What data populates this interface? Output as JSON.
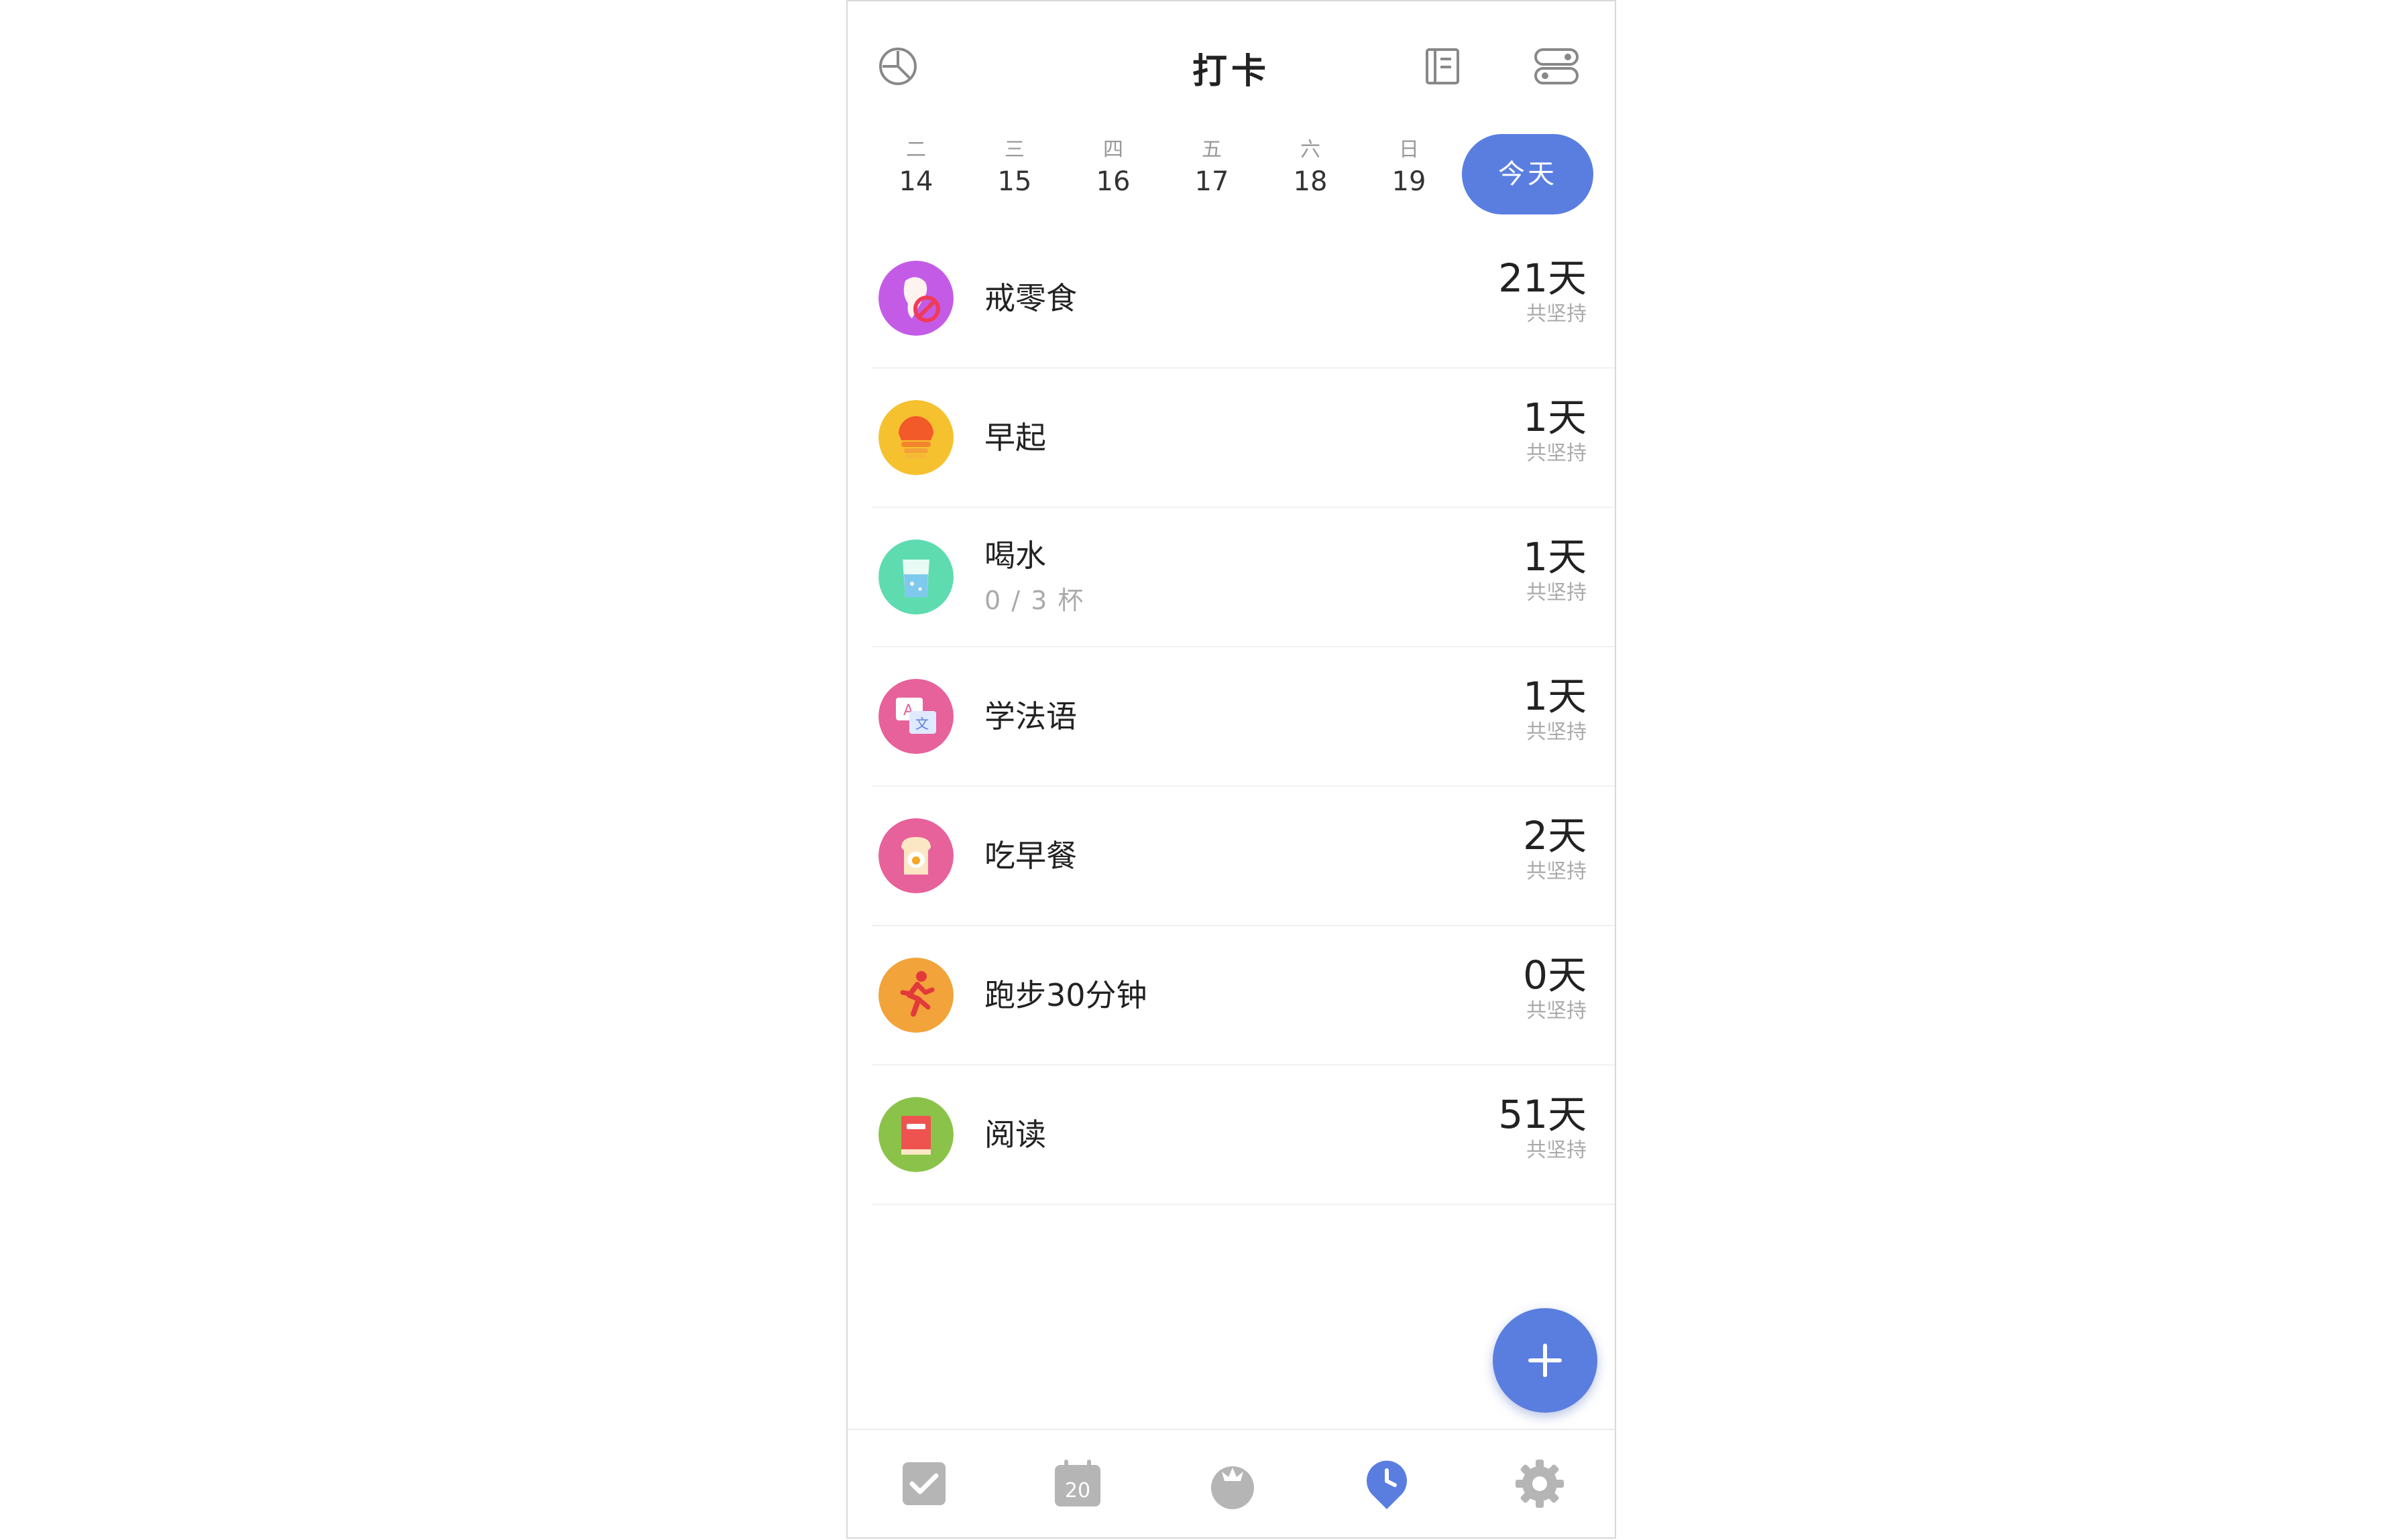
{
  "header": {
    "title": "打卡",
    "left_icon": "pie-chart-icon",
    "right_icons": [
      "notebook-icon",
      "toggle-list-icon"
    ]
  },
  "week": {
    "days": [
      {
        "weekday": "二",
        "date": "14"
      },
      {
        "weekday": "三",
        "date": "15"
      },
      {
        "weekday": "四",
        "date": "16"
      },
      {
        "weekday": "五",
        "date": "17"
      },
      {
        "weekday": "六",
        "date": "18"
      },
      {
        "weekday": "日",
        "date": "19"
      }
    ],
    "today_label": "今天"
  },
  "habits": [
    {
      "name": "戒零食",
      "sub": "",
      "days": "21天",
      "label": "共坚持",
      "icon": "no-snack-icon",
      "color": "#c45be6"
    },
    {
      "name": "早起",
      "sub": "",
      "days": "1天",
      "label": "共坚持",
      "icon": "sunrise-icon",
      "color": "#f6c12f"
    },
    {
      "name": "喝水",
      "sub": "0 / 3 杯",
      "days": "1天",
      "label": "共坚持",
      "icon": "water-glass-icon",
      "color": "#5fdbb0"
    },
    {
      "name": "学法语",
      "sub": "",
      "days": "1天",
      "label": "共坚持",
      "icon": "translate-icon",
      "color": "#e7619a"
    },
    {
      "name": "吃早餐",
      "sub": "",
      "days": "2天",
      "label": "共坚持",
      "icon": "toast-egg-icon",
      "color": "#e7619a"
    },
    {
      "name": "跑步30分钟",
      "sub": "",
      "days": "0天",
      "label": "共坚持",
      "icon": "running-icon",
      "color": "#f2a33a"
    },
    {
      "name": "阅读",
      "sub": "",
      "days": "51天",
      "label": "共坚持",
      "icon": "book-icon",
      "color": "#8bc34a"
    }
  ],
  "fab": {
    "icon": "plus-icon"
  },
  "tabs": [
    {
      "icon": "checkbox-icon",
      "active": false
    },
    {
      "icon": "calendar-icon",
      "text": "20",
      "active": false
    },
    {
      "icon": "tomato-icon",
      "active": false
    },
    {
      "icon": "clock-pin-icon",
      "active": true
    },
    {
      "icon": "gear-icon",
      "active": false
    }
  ],
  "colors": {
    "accent": "#5a7ee0",
    "tab_inactive": "#b5b5b5"
  }
}
